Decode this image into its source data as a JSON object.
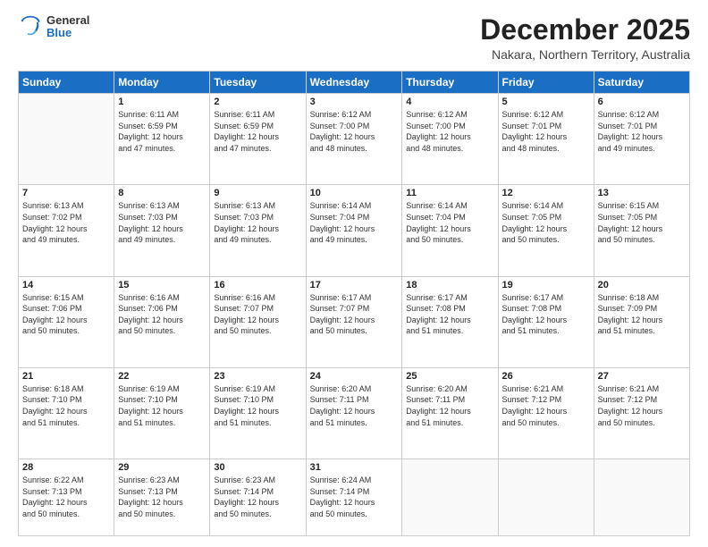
{
  "header": {
    "logo": {
      "line1": "General",
      "line2": "Blue"
    },
    "title": "December 2025",
    "location": "Nakara, Northern Territory, Australia"
  },
  "weekdays": [
    "Sunday",
    "Monday",
    "Tuesday",
    "Wednesday",
    "Thursday",
    "Friday",
    "Saturday"
  ],
  "weeks": [
    [
      {
        "day": "",
        "info": ""
      },
      {
        "day": "1",
        "info": "Sunrise: 6:11 AM\nSunset: 6:59 PM\nDaylight: 12 hours\nand 47 minutes."
      },
      {
        "day": "2",
        "info": "Sunrise: 6:11 AM\nSunset: 6:59 PM\nDaylight: 12 hours\nand 47 minutes."
      },
      {
        "day": "3",
        "info": "Sunrise: 6:12 AM\nSunset: 7:00 PM\nDaylight: 12 hours\nand 48 minutes."
      },
      {
        "day": "4",
        "info": "Sunrise: 6:12 AM\nSunset: 7:00 PM\nDaylight: 12 hours\nand 48 minutes."
      },
      {
        "day": "5",
        "info": "Sunrise: 6:12 AM\nSunset: 7:01 PM\nDaylight: 12 hours\nand 48 minutes."
      },
      {
        "day": "6",
        "info": "Sunrise: 6:12 AM\nSunset: 7:01 PM\nDaylight: 12 hours\nand 49 minutes."
      }
    ],
    [
      {
        "day": "7",
        "info": "Sunrise: 6:13 AM\nSunset: 7:02 PM\nDaylight: 12 hours\nand 49 minutes."
      },
      {
        "day": "8",
        "info": "Sunrise: 6:13 AM\nSunset: 7:03 PM\nDaylight: 12 hours\nand 49 minutes."
      },
      {
        "day": "9",
        "info": "Sunrise: 6:13 AM\nSunset: 7:03 PM\nDaylight: 12 hours\nand 49 minutes."
      },
      {
        "day": "10",
        "info": "Sunrise: 6:14 AM\nSunset: 7:04 PM\nDaylight: 12 hours\nand 49 minutes."
      },
      {
        "day": "11",
        "info": "Sunrise: 6:14 AM\nSunset: 7:04 PM\nDaylight: 12 hours\nand 50 minutes."
      },
      {
        "day": "12",
        "info": "Sunrise: 6:14 AM\nSunset: 7:05 PM\nDaylight: 12 hours\nand 50 minutes."
      },
      {
        "day": "13",
        "info": "Sunrise: 6:15 AM\nSunset: 7:05 PM\nDaylight: 12 hours\nand 50 minutes."
      }
    ],
    [
      {
        "day": "14",
        "info": "Sunrise: 6:15 AM\nSunset: 7:06 PM\nDaylight: 12 hours\nand 50 minutes."
      },
      {
        "day": "15",
        "info": "Sunrise: 6:16 AM\nSunset: 7:06 PM\nDaylight: 12 hours\nand 50 minutes."
      },
      {
        "day": "16",
        "info": "Sunrise: 6:16 AM\nSunset: 7:07 PM\nDaylight: 12 hours\nand 50 minutes."
      },
      {
        "day": "17",
        "info": "Sunrise: 6:17 AM\nSunset: 7:07 PM\nDaylight: 12 hours\nand 50 minutes."
      },
      {
        "day": "18",
        "info": "Sunrise: 6:17 AM\nSunset: 7:08 PM\nDaylight: 12 hours\nand 51 minutes."
      },
      {
        "day": "19",
        "info": "Sunrise: 6:17 AM\nSunset: 7:08 PM\nDaylight: 12 hours\nand 51 minutes."
      },
      {
        "day": "20",
        "info": "Sunrise: 6:18 AM\nSunset: 7:09 PM\nDaylight: 12 hours\nand 51 minutes."
      }
    ],
    [
      {
        "day": "21",
        "info": "Sunrise: 6:18 AM\nSunset: 7:10 PM\nDaylight: 12 hours\nand 51 minutes."
      },
      {
        "day": "22",
        "info": "Sunrise: 6:19 AM\nSunset: 7:10 PM\nDaylight: 12 hours\nand 51 minutes."
      },
      {
        "day": "23",
        "info": "Sunrise: 6:19 AM\nSunset: 7:10 PM\nDaylight: 12 hours\nand 51 minutes."
      },
      {
        "day": "24",
        "info": "Sunrise: 6:20 AM\nSunset: 7:11 PM\nDaylight: 12 hours\nand 51 minutes."
      },
      {
        "day": "25",
        "info": "Sunrise: 6:20 AM\nSunset: 7:11 PM\nDaylight: 12 hours\nand 51 minutes."
      },
      {
        "day": "26",
        "info": "Sunrise: 6:21 AM\nSunset: 7:12 PM\nDaylight: 12 hours\nand 50 minutes."
      },
      {
        "day": "27",
        "info": "Sunrise: 6:21 AM\nSunset: 7:12 PM\nDaylight: 12 hours\nand 50 minutes."
      }
    ],
    [
      {
        "day": "28",
        "info": "Sunrise: 6:22 AM\nSunset: 7:13 PM\nDaylight: 12 hours\nand 50 minutes."
      },
      {
        "day": "29",
        "info": "Sunrise: 6:23 AM\nSunset: 7:13 PM\nDaylight: 12 hours\nand 50 minutes."
      },
      {
        "day": "30",
        "info": "Sunrise: 6:23 AM\nSunset: 7:14 PM\nDaylight: 12 hours\nand 50 minutes."
      },
      {
        "day": "31",
        "info": "Sunrise: 6:24 AM\nSunset: 7:14 PM\nDaylight: 12 hours\nand 50 minutes."
      },
      {
        "day": "",
        "info": ""
      },
      {
        "day": "",
        "info": ""
      },
      {
        "day": "",
        "info": ""
      }
    ]
  ]
}
